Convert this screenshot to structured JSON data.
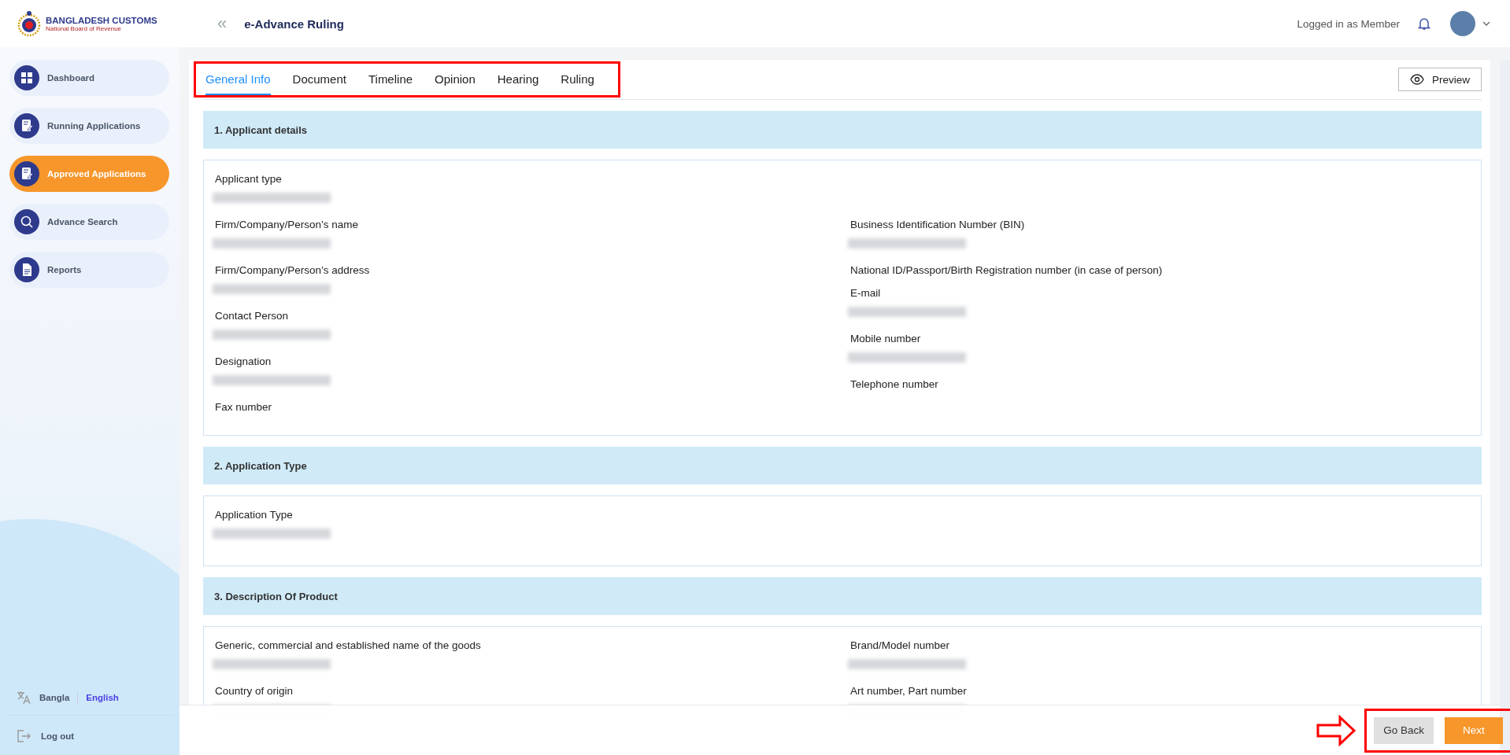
{
  "header": {
    "logo_title": "BANGLADESH CUSTOMS",
    "logo_subtitle": "National Board of Revenue",
    "collapse_glyph": "«",
    "page_title": "e-Advance Ruling",
    "user_label": "Logged in as Member"
  },
  "sidebar": {
    "items": [
      {
        "label": "Dashboard",
        "kind": "grid",
        "selected": false
      },
      {
        "label": "Running Applications",
        "kind": "doc-edit",
        "selected": false
      },
      {
        "label": "Approved Applications",
        "kind": "doc-edit",
        "selected": true
      },
      {
        "label": "Advance Search",
        "kind": "search",
        "selected": false
      },
      {
        "label": "Reports",
        "kind": "report",
        "selected": false
      }
    ],
    "languages": [
      {
        "label": "Bangla",
        "selected": false
      },
      {
        "label": "English",
        "selected": true
      }
    ],
    "logout": "Log out"
  },
  "tabs": {
    "highlighted": true,
    "items": [
      {
        "label": "General Info",
        "selected": true
      },
      {
        "label": "Document",
        "selected": false
      },
      {
        "label": "Timeline",
        "selected": false
      },
      {
        "label": "Opinion",
        "selected": false
      },
      {
        "label": "Hearing",
        "selected": false
      },
      {
        "label": "Ruling",
        "selected": false
      }
    ]
  },
  "preview_button": "Preview",
  "sections": [
    {
      "title": "1. Applicant details",
      "top": [
        {
          "label": "Applicant type",
          "value_hidden": true
        }
      ],
      "left": [
        {
          "label": "Firm/Company/Person’s name",
          "value_hidden": true
        },
        {
          "label": "Firm/Company/Person’s address",
          "value_hidden": true
        },
        {
          "label": "Contact Person",
          "value_hidden": true
        },
        {
          "label": "Designation",
          "value_hidden": true
        },
        {
          "label": "Fax number",
          "value_hidden": false
        }
      ],
      "right": [
        {
          "label": "Business Identification Number (BIN)",
          "value_hidden": true
        },
        {
          "label": "National ID/Passport/Birth Registration number (in case of person)",
          "value_hidden": false
        },
        {
          "label": "E-mail",
          "value_hidden": true
        },
        {
          "label": "Mobile number",
          "value_hidden": true
        },
        {
          "label": "Telephone number",
          "value_hidden": false
        }
      ]
    },
    {
      "title": "2. Application Type",
      "top": [
        {
          "label": "Application Type",
          "value_hidden": true
        }
      ]
    },
    {
      "title": "3. Description Of Product",
      "left": [
        {
          "label": "Generic, commercial and established name of the goods",
          "value_hidden": true
        },
        {
          "label": "Country of origin",
          "value_hidden": true
        }
      ],
      "right": [
        {
          "label": "Brand/Model number",
          "value_hidden": true
        },
        {
          "label": "Art number, Part number",
          "value_hidden": true
        }
      ]
    }
  ],
  "footer": {
    "highlighted": true,
    "buttons": [
      {
        "label": "Go Back",
        "kind": "secondary"
      },
      {
        "label": "Next",
        "kind": "primary"
      }
    ]
  }
}
